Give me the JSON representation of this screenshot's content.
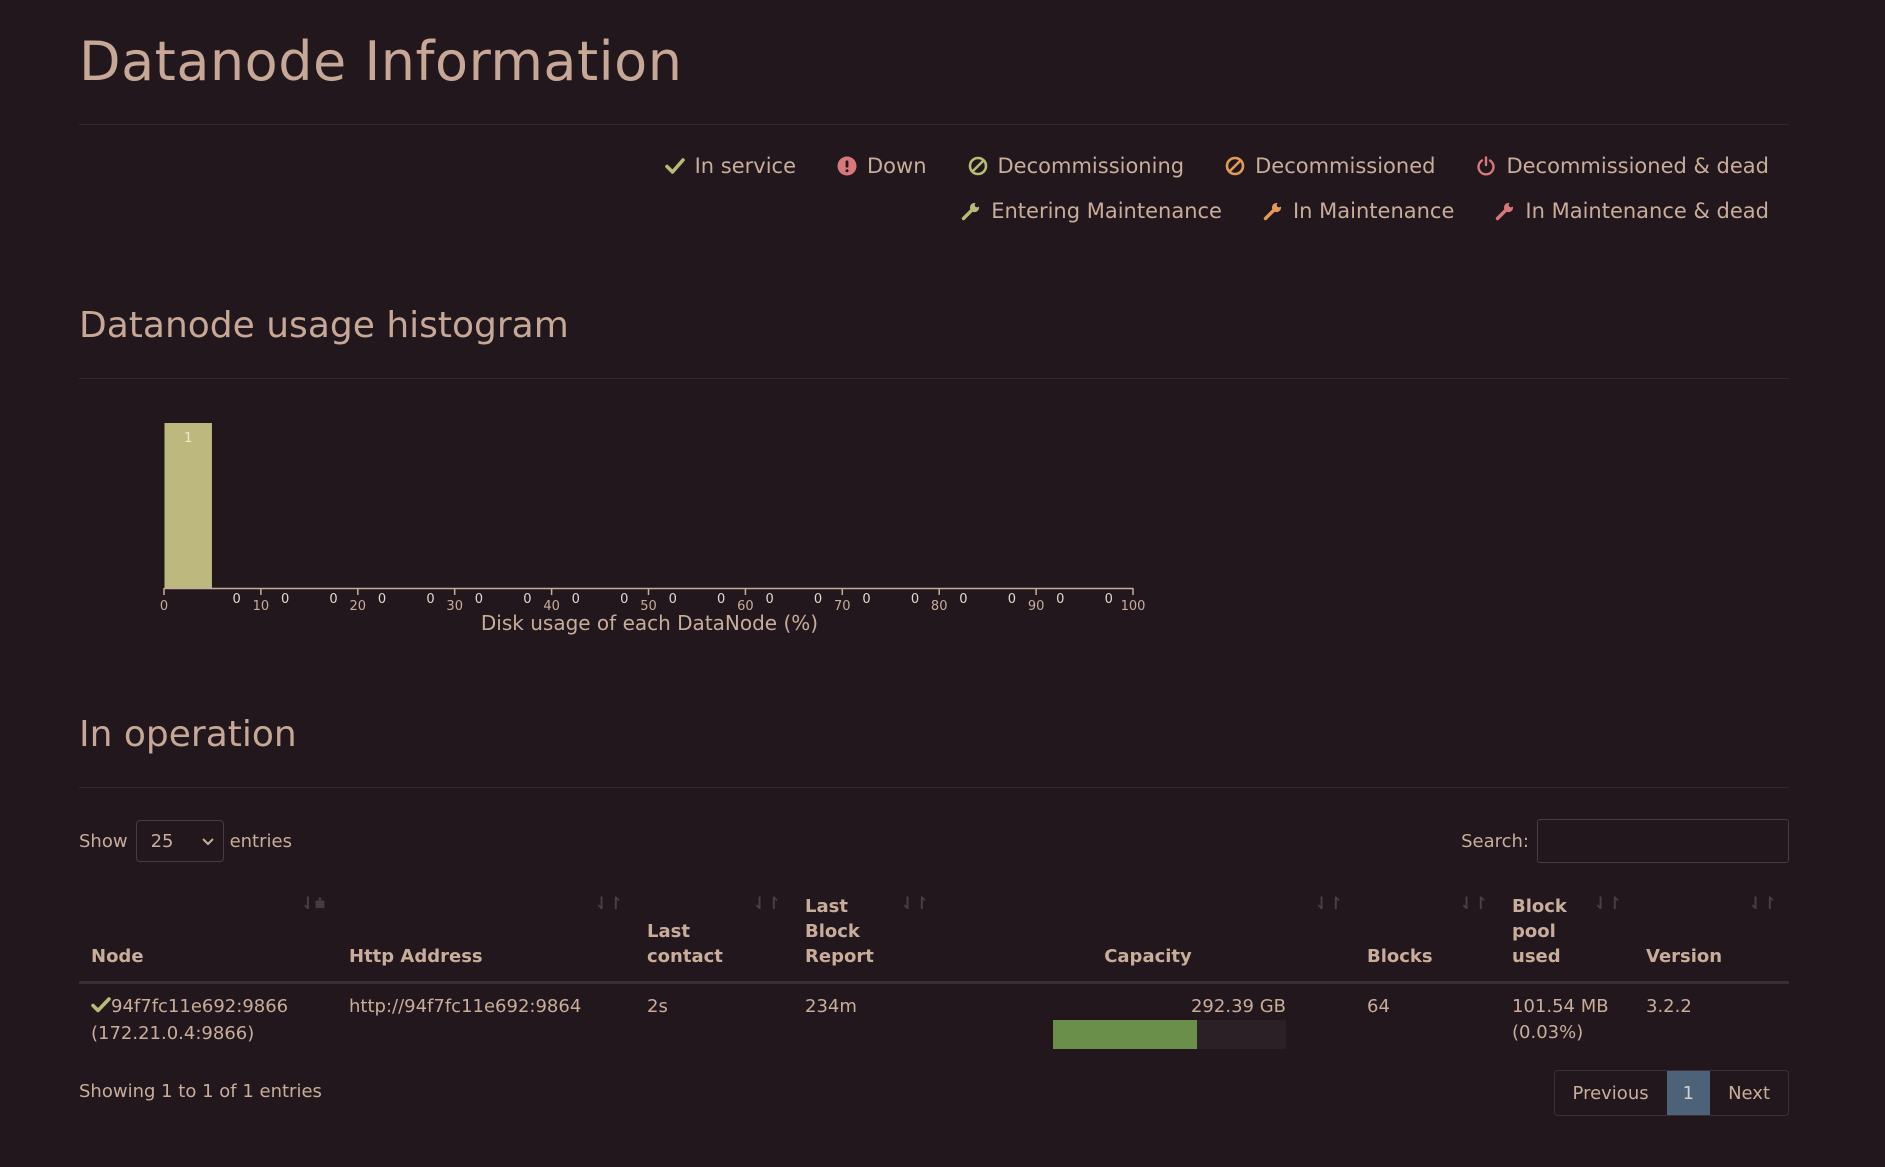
{
  "page": {
    "title": "Datanode Information"
  },
  "legend": [
    {
      "label": "In service",
      "icon": "check-icon",
      "color": "#b6bb76"
    },
    {
      "label": "Down",
      "icon": "exclamation-circle-icon",
      "color": "#d9787a"
    },
    {
      "label": "Decommissioning",
      "icon": "ban-icon",
      "color": "#b6bb76"
    },
    {
      "label": "Decommissioned",
      "icon": "ban-icon",
      "color": "#e29a58"
    },
    {
      "label": "Decommissioned & dead",
      "icon": "power-icon",
      "color": "#d9787a"
    },
    {
      "label": "Entering Maintenance",
      "icon": "wrench-icon",
      "color": "#b6bb76"
    },
    {
      "label": "In Maintenance",
      "icon": "wrench-icon",
      "color": "#e29a58"
    },
    {
      "label": "In Maintenance & dead",
      "icon": "wrench-icon",
      "color": "#d9787a"
    }
  ],
  "histogram": {
    "heading": "Datanode usage histogram"
  },
  "chart_data": {
    "type": "bar",
    "xlabel": "Disk usage of each DataNode (%)",
    "ylabel": "",
    "x_ticks": [
      0,
      10,
      20,
      30,
      40,
      50,
      60,
      70,
      80,
      90,
      100
    ],
    "bins": [
      {
        "range": [
          0,
          5
        ],
        "value": 1
      },
      {
        "range": [
          5,
          10
        ],
        "value": 0
      },
      {
        "range": [
          10,
          15
        ],
        "value": 0
      },
      {
        "range": [
          15,
          20
        ],
        "value": 0
      },
      {
        "range": [
          20,
          25
        ],
        "value": 0
      },
      {
        "range": [
          25,
          30
        ],
        "value": 0
      },
      {
        "range": [
          30,
          35
        ],
        "value": 0
      },
      {
        "range": [
          35,
          40
        ],
        "value": 0
      },
      {
        "range": [
          40,
          45
        ],
        "value": 0
      },
      {
        "range": [
          45,
          50
        ],
        "value": 0
      },
      {
        "range": [
          50,
          55
        ],
        "value": 0
      },
      {
        "range": [
          55,
          60
        ],
        "value": 0
      },
      {
        "range": [
          60,
          65
        ],
        "value": 0
      },
      {
        "range": [
          65,
          70
        ],
        "value": 0
      },
      {
        "range": [
          70,
          75
        ],
        "value": 0
      },
      {
        "range": [
          75,
          80
        ],
        "value": 0
      },
      {
        "range": [
          80,
          85
        ],
        "value": 0
      },
      {
        "range": [
          85,
          90
        ],
        "value": 0
      },
      {
        "range": [
          90,
          95
        ],
        "value": 0
      },
      {
        "range": [
          95,
          100
        ],
        "value": 0
      }
    ],
    "xlim": [
      0,
      100
    ],
    "ylim": [
      0,
      1
    ],
    "bar_color": "#bdb97e",
    "grid": false
  },
  "operation": {
    "heading": "In operation",
    "show_label": "Show",
    "entries_label": "entries",
    "page_size": "25",
    "search_label": "Search:",
    "search_value": "",
    "columns": [
      "Node",
      "Http Address",
      "Last contact",
      "Last Block Report",
      "Capacity",
      "Blocks",
      "Block pool used",
      "Version"
    ],
    "rows": [
      {
        "node": "94f7fc11e692:9866",
        "node_ip": "(172.21.0.4:9866)",
        "http": "http://94f7fc11e692:9864",
        "last_contact": "2s",
        "last_block_report": "234m",
        "capacity": "292.39 GB",
        "capacity_used_fraction": 0.62,
        "blocks": "64",
        "block_pool_used": "101.54 MB",
        "block_pool_pct": "(0.03%)",
        "version": "3.2.2"
      }
    ],
    "info": "Showing 1 to 1 of 1 entries",
    "pager": {
      "previous": "Previous",
      "current": "1",
      "next": "Next"
    }
  }
}
